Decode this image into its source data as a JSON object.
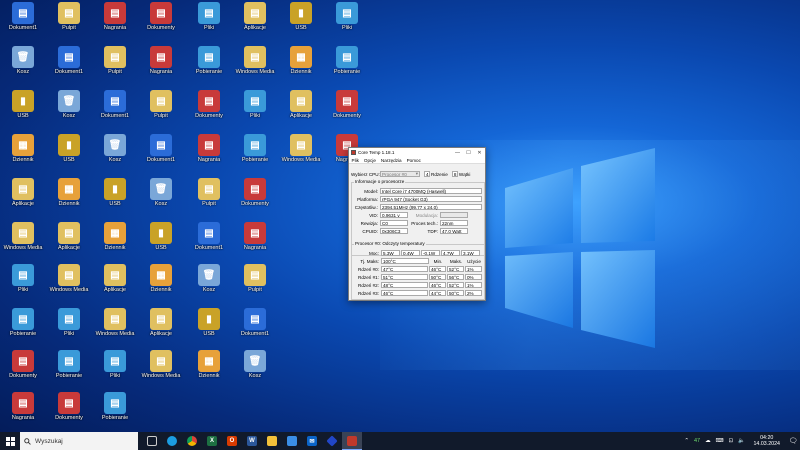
{
  "desktop": {
    "icons": [
      {
        "label": "Dokument1",
        "glyph": "▤",
        "color": "#2b6cd8"
      },
      {
        "label": "Kosz",
        "glyph": "🗑",
        "color": "#7aa7d8"
      },
      {
        "label": "USB",
        "glyph": "▮",
        "color": "#c9a227"
      },
      {
        "label": "Dziennik",
        "glyph": "▦",
        "color": "#e7a13a"
      },
      {
        "label": "Aplikacje",
        "glyph": "▤",
        "color": "#e0c060"
      },
      {
        "label": "Windows Media",
        "glyph": "▤",
        "color": "#e0c060"
      },
      {
        "label": "Pliki",
        "glyph": "▤",
        "color": "#3a9ad9"
      },
      {
        "label": "Pobieranie",
        "glyph": "▤",
        "color": "#3a9ad9"
      },
      {
        "label": "Dokumenty",
        "glyph": "▤",
        "color": "#c83a3a"
      },
      {
        "label": "Nagrania",
        "glyph": "▤",
        "color": "#c83a3a"
      },
      {
        "label": "Pulpit",
        "glyph": "▤",
        "color": "#e0c060"
      }
    ]
  },
  "coretemp": {
    "title": "Core Temp 1.18.1",
    "menu": [
      "Plik",
      "Opcje",
      "Narzędzia",
      "Pomoc"
    ],
    "select_cpu_label": "Wybierz CPU:",
    "select_cpu_value": "Procesor #0",
    "cores": "4",
    "cores_label": "Rdzenie",
    "threads": "8",
    "threads_label": "Wątki",
    "info_title": "Informacje o procesorze",
    "model_label": "Model:",
    "model": "Intel Core i7 4700MQ (Haswell)",
    "platform_label": "Platforma:",
    "platform": "rPGA 947 (Socket G3)",
    "freq_label": "Częstotliw.:",
    "freq": "2394.51MHz (99.77 x 24.0)",
    "vid_label": "VID:",
    "vid": "0.9631 v",
    "modulation_label": "Modulacja:",
    "modulation": "",
    "revision_label": "Rewizja:",
    "revision": "C0",
    "process_label": "Proces tech.:",
    "process": "22nm",
    "cpuid_label": "CPUID:",
    "cpuid": "0x306C3",
    "tdp_label": "TDP:",
    "tdp": "47.0 Watt",
    "readings_title": "Procesor #0: Odczyty temperatury",
    "power_label": "Moc:",
    "power": [
      "5.3W",
      "0.4W",
      "-0.1W",
      "4.7W",
      "3.1W"
    ],
    "tjmax_label": "Tj. Maks:",
    "tjmax": "100°C",
    "col_min": "Min.",
    "col_max": "Maks.",
    "col_load": "Użycie",
    "rows": [
      {
        "name": "Rdzeń #0:",
        "temp": "47°C",
        "min": "46°C",
        "max": "52°C",
        "load": "1%"
      },
      {
        "name": "Rdzeń #1:",
        "temp": "51°C",
        "min": "50°C",
        "max": "56°C",
        "load": "0%"
      },
      {
        "name": "Rdzeń #2:",
        "temp": "48°C",
        "min": "46°C",
        "max": "52°C",
        "load": "1%"
      },
      {
        "name": "Rdzeń #3:",
        "temp": "46°C",
        "min": "44°C",
        "max": "50°C",
        "load": "2%"
      }
    ]
  },
  "taskbar": {
    "search_placeholder": "Wyszukaj",
    "tray_temp": "47",
    "clock_time": "04:20",
    "clock_date": "14.03.2024"
  }
}
